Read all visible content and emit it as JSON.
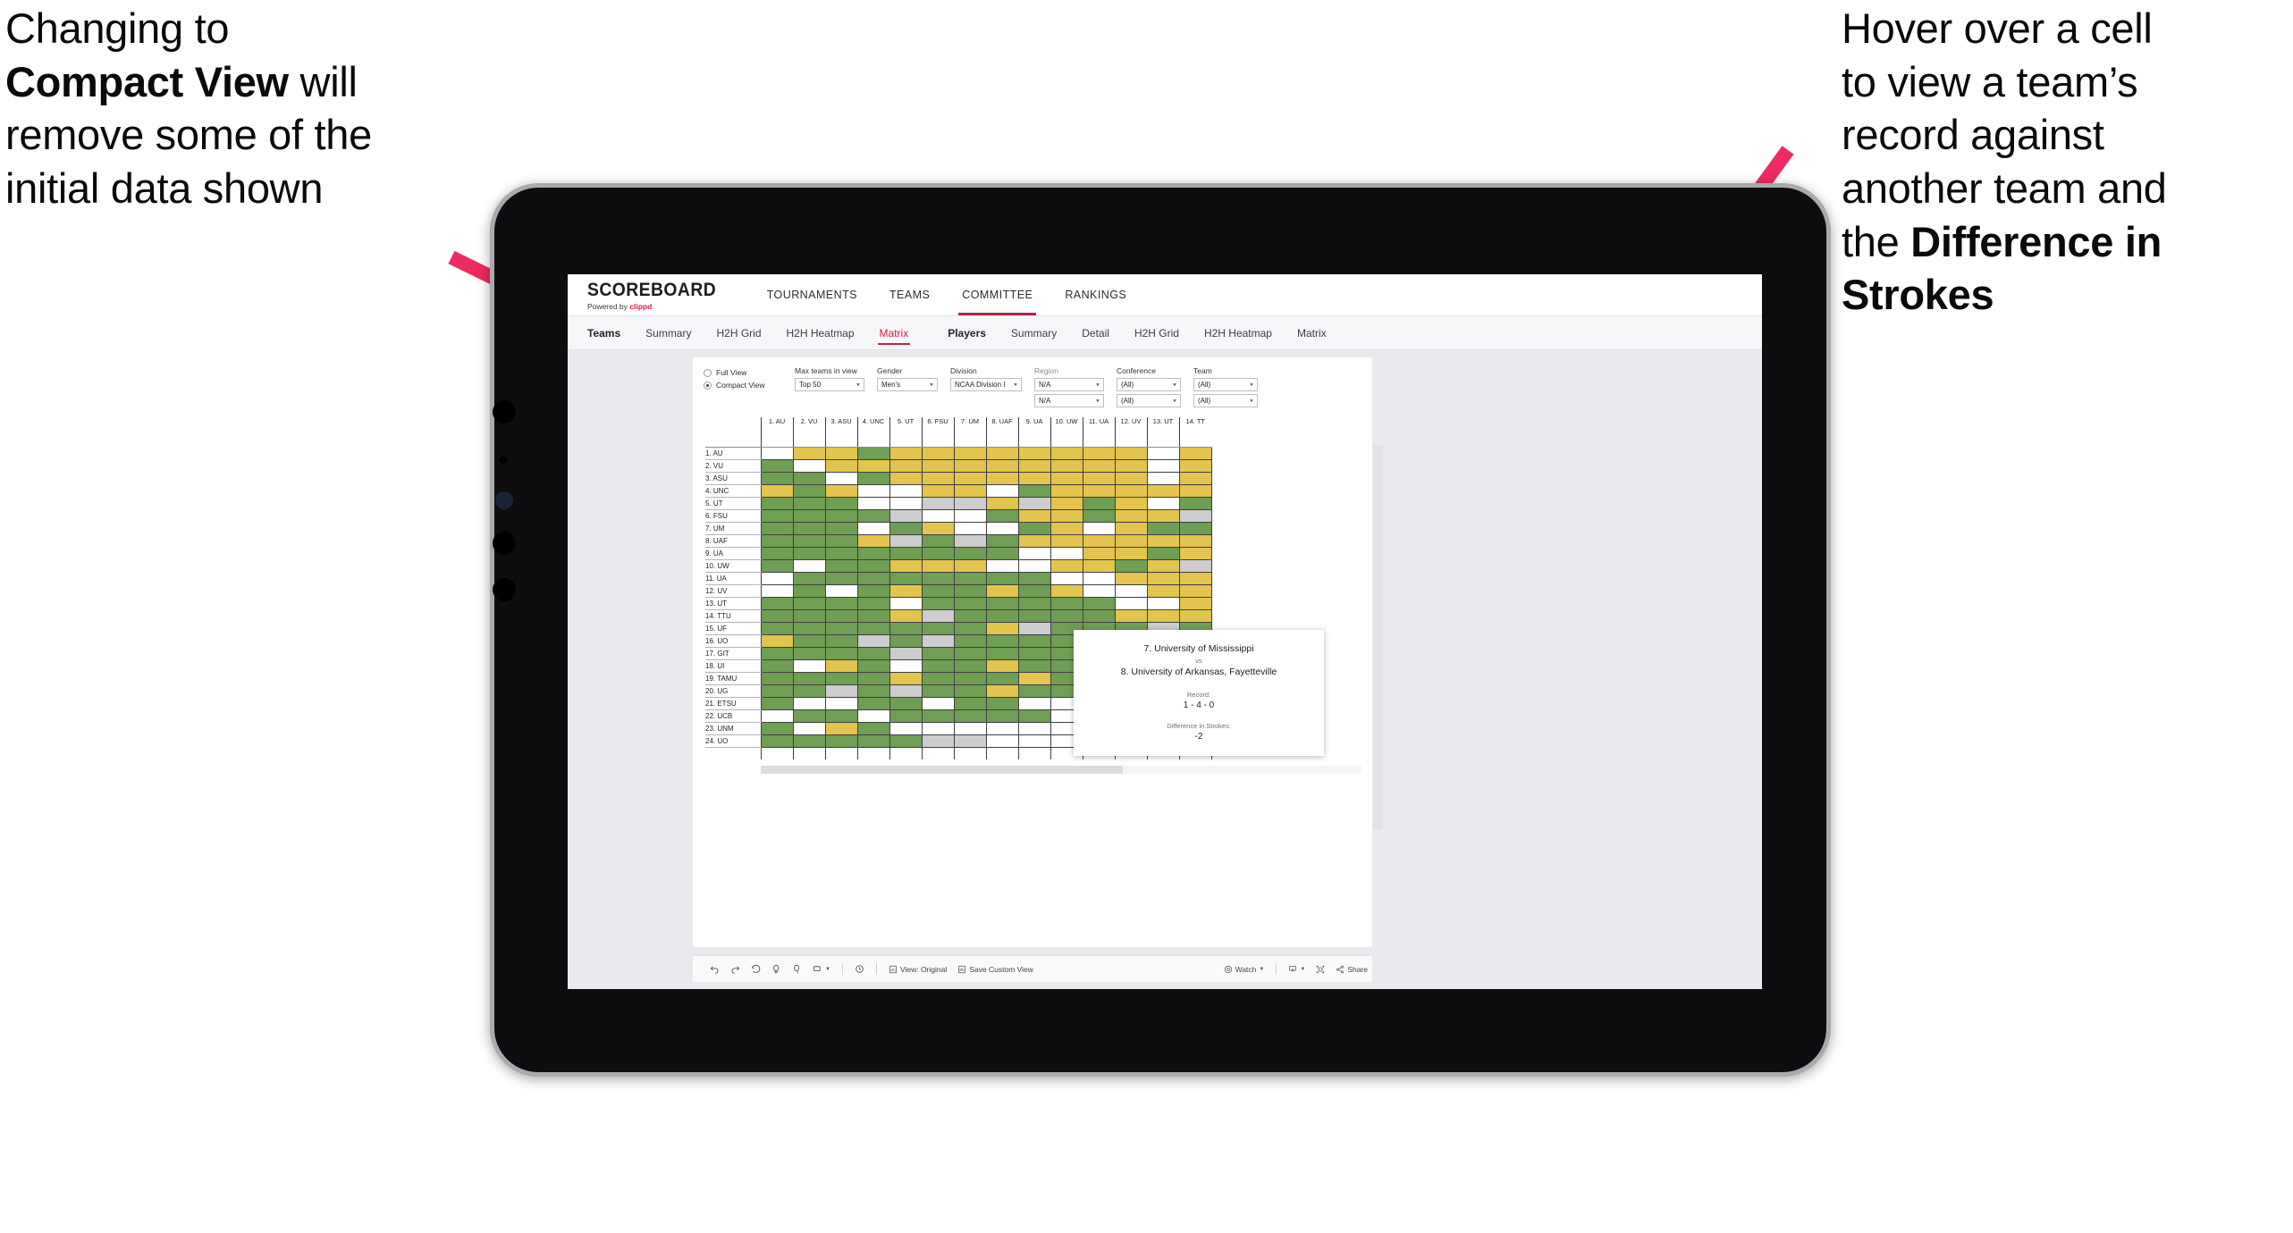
{
  "annotations": {
    "left": {
      "part1": "Changing to\n",
      "bold": "Compact View",
      "part2": " will\nremove some of the\ninitial data shown"
    },
    "right": {
      "part1": "Hover over a cell\nto view a team’s\nrecord against\nanother team and\nthe ",
      "bold": "Difference in\nStrokes",
      "part2": ""
    },
    "accent_color": "#ee2b62"
  },
  "app": {
    "brand": {
      "name": "SCOREBOARD",
      "powered_prefix": "Powered by ",
      "powered_brand": "clippd"
    },
    "topnav": [
      {
        "label": "TOURNAMENTS",
        "active": false
      },
      {
        "label": "TEAMS",
        "active": false
      },
      {
        "label": "COMMITTEE",
        "active": true
      },
      {
        "label": "RANKINGS",
        "active": false
      }
    ],
    "subnav": {
      "teams_group": {
        "head": "Teams",
        "items": [
          {
            "label": "Summary",
            "active": false
          },
          {
            "label": "H2H Grid",
            "active": false
          },
          {
            "label": "H2H Heatmap",
            "active": false
          },
          {
            "label": "Matrix",
            "active": true
          }
        ]
      },
      "players_group": {
        "head": "Players",
        "items": [
          {
            "label": "Summary",
            "active": false
          },
          {
            "label": "Detail",
            "active": false
          },
          {
            "label": "H2H Grid",
            "active": false
          },
          {
            "label": "H2H Heatmap",
            "active": false
          },
          {
            "label": "Matrix",
            "active": false
          }
        ]
      }
    },
    "filters": {
      "view_mode": {
        "options": [
          "Full View",
          "Compact View"
        ],
        "selected": "Compact View"
      },
      "max_teams": {
        "label": "Max teams in view",
        "value": "Top 50"
      },
      "gender": {
        "label": "Gender",
        "value": "Men's"
      },
      "division": {
        "label": "Division",
        "value": "NCAA Division I"
      },
      "region": {
        "label": "Region",
        "value1": "N/A",
        "value2": "N/A"
      },
      "conference": {
        "label": "Conference",
        "value1": "(All)",
        "value2": "(All)"
      },
      "team": {
        "label": "Team",
        "value1": "(All)",
        "value2": "(All)"
      }
    },
    "tooltip": {
      "team_a": "7. University of Mississippi",
      "vs": "vs",
      "team_b": "8. University of Arkansas, Fayetteville",
      "record_label": "Record:",
      "record_value": "1 - 4 - 0",
      "strokes_label": "Difference in Strokes:",
      "strokes_value": "-2"
    },
    "toolbar": {
      "items": [
        {
          "name": "undo-icon",
          "label": ""
        },
        {
          "name": "redo-icon",
          "label": ""
        },
        {
          "name": "revert-icon",
          "label": ""
        },
        {
          "name": "refresh-icon",
          "label": ""
        },
        {
          "name": "pause-icon",
          "label": ""
        },
        {
          "name": "shape-icon",
          "label": ""
        }
      ],
      "view_original": "View: Original",
      "save_custom_view": "Save Custom View",
      "watch": "Watch",
      "share": "Share"
    }
  },
  "chart_data": {
    "type": "heatmap",
    "title": "Head-to-Head Team Matrix",
    "legend": {
      "green": "#6f9e55",
      "yellow": "#e3c44e",
      "grey": "#cdcdd0",
      "white": "#ffffff"
    },
    "col_headers": [
      "1. AU",
      "2. VU",
      "3. ASU",
      "4. UNC",
      "5. UT",
      "6. FSU",
      "7. UM",
      "8. UAF",
      "9. UA",
      "10. UW",
      "11. UA",
      "12. UV",
      "13. UT",
      "14. TT"
    ],
    "row_headers": [
      "1. AU",
      "2. VU",
      "3. ASU",
      "4. UNC",
      "5. UT",
      "6. FSU",
      "7. UM",
      "8. UAF",
      "9. UA",
      "10. UW",
      "11. UA",
      "12. UV",
      "13. UT",
      "14. TTU",
      "15. UF",
      "16. UO",
      "17. GIT",
      "18. UI",
      "19. TAMU",
      "20. UG",
      "21. ETSU",
      "22. UCB",
      "23. UNM",
      "24. UO"
    ],
    "cells": [
      [
        "w",
        "y",
        "y",
        "g",
        "y",
        "y",
        "y",
        "y",
        "y",
        "y",
        "y",
        "y",
        "w",
        "y"
      ],
      [
        "g",
        "w",
        "y",
        "y",
        "y",
        "y",
        "y",
        "y",
        "y",
        "y",
        "y",
        "y",
        "w",
        "y"
      ],
      [
        "g",
        "g",
        "w",
        "g",
        "y",
        "y",
        "y",
        "y",
        "y",
        "y",
        "y",
        "y",
        "w",
        "y"
      ],
      [
        "y",
        "g",
        "y",
        "w",
        "w",
        "y",
        "y",
        "w",
        "g",
        "y",
        "y",
        "y",
        "y",
        "y"
      ],
      [
        "g",
        "g",
        "g",
        "w",
        "w",
        "x",
        "x",
        "y",
        "x",
        "y",
        "g",
        "y",
        "w",
        "g"
      ],
      [
        "g",
        "g",
        "g",
        "g",
        "x",
        "w",
        "w",
        "g",
        "y",
        "y",
        "g",
        "y",
        "y",
        "x"
      ],
      [
        "g",
        "g",
        "g",
        "w",
        "g",
        "y",
        "w",
        "w",
        "g",
        "y",
        "w",
        "y",
        "g",
        "g"
      ],
      [
        "g",
        "g",
        "g",
        "y",
        "x",
        "g",
        "x",
        "g",
        "y",
        "y",
        "y",
        "y",
        "y",
        "y"
      ],
      [
        "g",
        "g",
        "g",
        "g",
        "g",
        "g",
        "g",
        "g",
        "w",
        "w",
        "y",
        "y",
        "g",
        "y"
      ],
      [
        "g",
        "w",
        "g",
        "g",
        "y",
        "y",
        "y",
        "w",
        "w",
        "y",
        "y",
        "g",
        "y",
        "x"
      ],
      [
        "w",
        "g",
        "g",
        "g",
        "g",
        "g",
        "g",
        "g",
        "g",
        "w",
        "w",
        "y",
        "y",
        "y"
      ],
      [
        "w",
        "g",
        "w",
        "g",
        "y",
        "g",
        "g",
        "y",
        "g",
        "y",
        "w",
        "w",
        "y",
        "y"
      ],
      [
        "g",
        "g",
        "g",
        "g",
        "w",
        "g",
        "g",
        "g",
        "g",
        "g",
        "g",
        "w",
        "w",
        "y"
      ],
      [
        "g",
        "g",
        "g",
        "g",
        "y",
        "x",
        "g",
        "g",
        "g",
        "g",
        "g",
        "y",
        "y",
        "y"
      ],
      [
        "g",
        "g",
        "g",
        "g",
        "g",
        "g",
        "g",
        "y",
        "x",
        "g",
        "g",
        "g",
        "x",
        "g"
      ],
      [
        "y",
        "g",
        "g",
        "x",
        "g",
        "x",
        "g",
        "g",
        "g",
        "g",
        "g",
        "x",
        "y",
        "y"
      ],
      [
        "g",
        "g",
        "g",
        "g",
        "x",
        "g",
        "g",
        "g",
        "g",
        "g",
        "g",
        "x",
        "y",
        "x"
      ],
      [
        "g",
        "w",
        "y",
        "g",
        "w",
        "g",
        "g",
        "y",
        "g",
        "g",
        "g",
        "y",
        "g",
        "y"
      ],
      [
        "g",
        "g",
        "g",
        "g",
        "y",
        "g",
        "g",
        "g",
        "y",
        "g",
        "g",
        "g",
        "x",
        "y"
      ],
      [
        "g",
        "g",
        "x",
        "g",
        "x",
        "g",
        "g",
        "y",
        "g",
        "g",
        "w",
        "w",
        "g",
        "x"
      ],
      [
        "g",
        "w",
        "w",
        "g",
        "g",
        "w",
        "g",
        "g",
        "w",
        "w",
        "y",
        "w",
        "g",
        "y"
      ],
      [
        "w",
        "g",
        "g",
        "w",
        "g",
        "g",
        "g",
        "g",
        "g",
        "w",
        "g",
        "y",
        "w",
        "y"
      ],
      [
        "g",
        "w",
        "y",
        "g",
        "w",
        "w",
        "w",
        "w",
        "w",
        "w",
        "y",
        "g",
        "w",
        "g"
      ],
      [
        "g",
        "g",
        "g",
        "g",
        "g",
        "x",
        "x",
        "w",
        "w",
        "w",
        "g",
        "y",
        "w",
        "g"
      ]
    ]
  }
}
